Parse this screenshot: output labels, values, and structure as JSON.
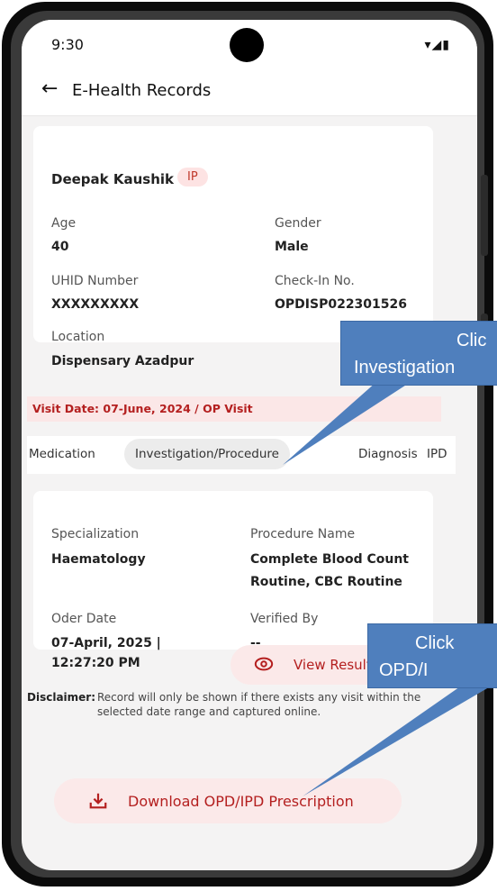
{
  "status_bar": {
    "time": "9:30",
    "icons": "▾◢▮"
  },
  "app_bar": {
    "back_icon": "←",
    "title": "E-Health Records"
  },
  "patient": {
    "name": "Deepak Kaushik",
    "badge": "IP",
    "age_label": "Age",
    "age_value": "40",
    "gender_label": "Gender",
    "gender_value": "Male",
    "uhid_label": "UHID Number",
    "uhid_value": "XXXXXXXXX",
    "checkin_label": "Check-In No.",
    "checkin_value": "OPDISP022301526",
    "location_label": "Location",
    "location_value": "Dispensary Azadpur"
  },
  "visit": {
    "text": "Visit Date: 07-June, 2024 / OP Visit"
  },
  "tabs": [
    {
      "label": "Medication",
      "active": false
    },
    {
      "label": "Investigation/Procedure",
      "active": true
    },
    {
      "label": "Diagnosis",
      "active": false
    },
    {
      "label": "IPD",
      "active": false
    }
  ],
  "record": {
    "specialization_label": "Specialization",
    "specialization_value": "Haematology",
    "procedure_label": "Procedure Name",
    "procedure_value_line1": "Complete Blood Count",
    "procedure_value_line2": "Routine, CBC Routine",
    "order_date_label": "Oder Date",
    "order_date_line1": "07-April, 2025 |",
    "order_date_line2": "12:27:20 PM",
    "verified_label": "Verified By",
    "verified_value": "--",
    "view_button": "View Result"
  },
  "disclaimer": {
    "label": "Disclaimer:",
    "text": "Record will only be shown if there exists any visit within the selected date range and captured online."
  },
  "download_button": "Download OPD/IPD Prescription",
  "callouts": {
    "one_line1": "Clic",
    "one_line2": "Investigation",
    "two_line1": "Click",
    "two_line2": "OPD/I"
  },
  "colors": {
    "accent": "#b41f1f",
    "callout": "#4f7fbd",
    "badge_bg": "#fde3e3"
  }
}
